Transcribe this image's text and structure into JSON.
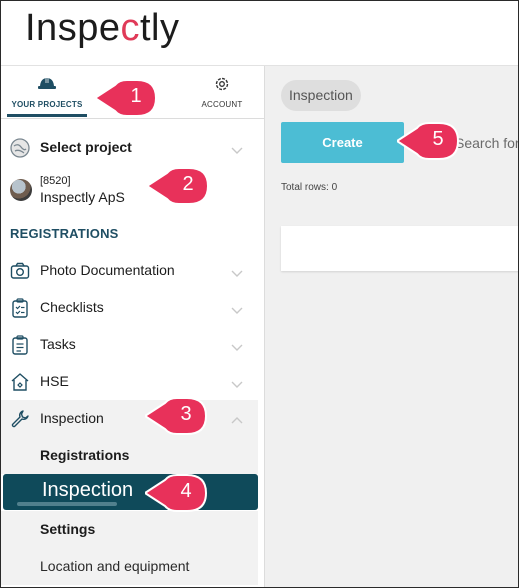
{
  "app": {
    "logo_prefix": "Inspe",
    "logo_c": "c",
    "logo_suffix": "tly",
    "colors": {
      "primary": "#1f4e63",
      "accent": "#4cbdd4",
      "brand_c": "#e03a58",
      "callout": "#e8315a",
      "selected_bg": "#0f4a5a"
    }
  },
  "sidebar": {
    "tabs": [
      {
        "label": "YOUR PROJECTS",
        "icon": "hard-hat-icon",
        "active": true
      },
      {
        "label": "ACCOUNT",
        "icon": "gear-icon",
        "active": false
      }
    ],
    "select_project": {
      "label": "Select project",
      "icon": "globe-icon"
    },
    "company": {
      "code": "[8520]",
      "name": "Inspectly ApS",
      "icon": "avatar"
    },
    "section_heading": "REGISTRATIONS",
    "items": [
      {
        "label": "Photo Documentation",
        "icon": "camera-icon"
      },
      {
        "label": "Checklists",
        "icon": "checklist-icon"
      },
      {
        "label": "Tasks",
        "icon": "clipboard-icon"
      },
      {
        "label": "HSE",
        "icon": "house-icon"
      },
      {
        "label": "Inspection",
        "icon": "wrench-icon",
        "expanded": true
      }
    ],
    "subitems": [
      {
        "label": "Registrations",
        "style": "bold"
      },
      {
        "label": "Inspection",
        "style": "selected"
      },
      {
        "label": "Settings",
        "style": "bold"
      },
      {
        "label": "Location and equipment",
        "style": "plain"
      }
    ]
  },
  "main": {
    "breadcrumb_chip": "Inspection",
    "create_label": "Create",
    "search_placeholder": "Search for",
    "total_rows": "Total rows: 0"
  },
  "callouts": [
    "1",
    "2",
    "3",
    "4",
    "5"
  ]
}
